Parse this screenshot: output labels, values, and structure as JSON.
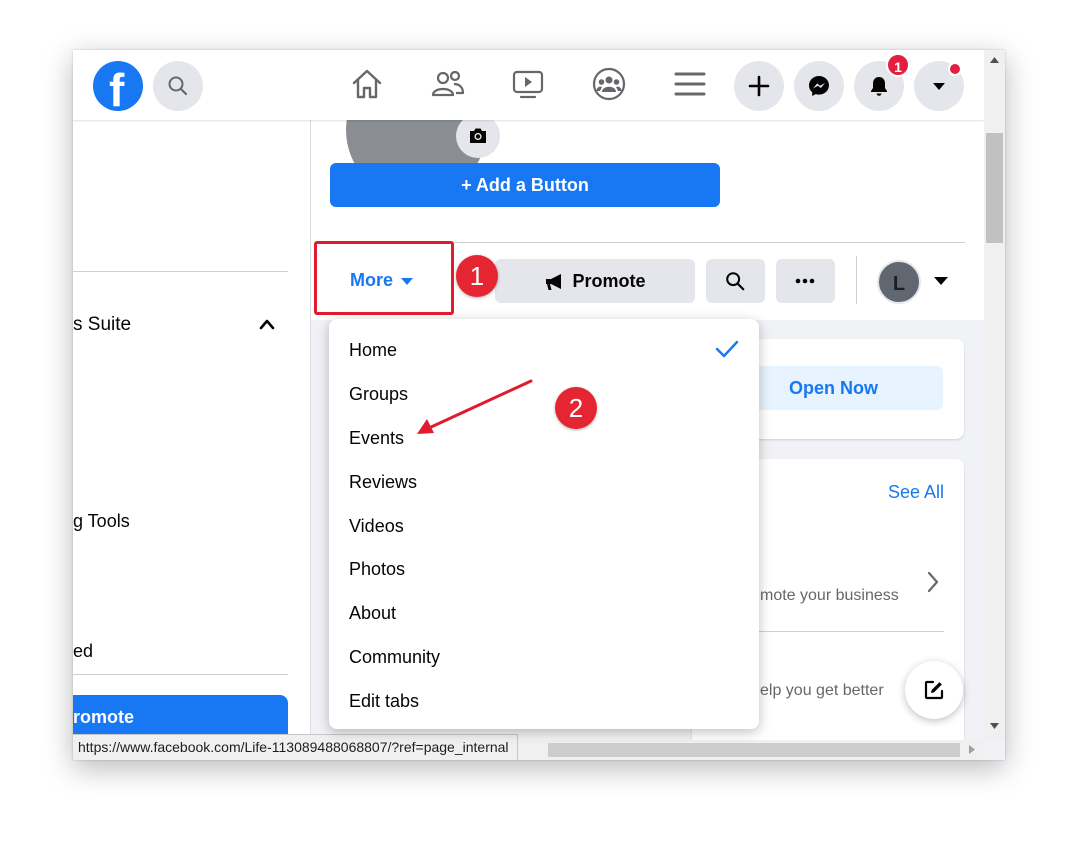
{
  "topbar": {
    "logo_letter": "f",
    "notification_count": "1"
  },
  "sidebar": {
    "items": [
      "s Suite",
      "g Tools",
      "ed"
    ],
    "promote_label": "romote"
  },
  "page": {
    "add_button_label": "+ Add a Button",
    "more_tab_label": "More",
    "promote_label": "Promote",
    "profile_initial": "L"
  },
  "right": {
    "open_now_label": "Open Now",
    "see_all_label": "See All",
    "text_1": "mote your business",
    "text_2": "elp you get better"
  },
  "more_menu": {
    "items": [
      "Home",
      "Groups",
      "Events",
      "Reviews",
      "Videos",
      "Photos",
      "About",
      "Community",
      "Edit tabs"
    ],
    "checked_item": "Home"
  },
  "annotations": {
    "step1": "1",
    "step2": "2"
  },
  "status_bar": {
    "url": "https://www.facebook.com/Life-113089488068807/?ref=page_internal"
  },
  "colors": {
    "brand_blue": "#1877f2",
    "annotation_red": "#e52531"
  }
}
